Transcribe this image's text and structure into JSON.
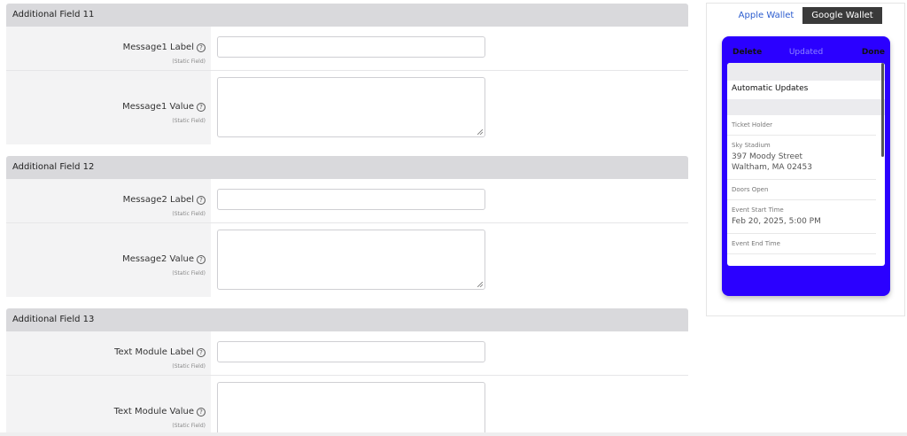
{
  "sections": [
    {
      "title": "Additional Field 11",
      "fields": [
        {
          "label": "Message1 Label",
          "sub": "(Static Field)",
          "type": "input",
          "value": ""
        },
        {
          "label": "Message1 Value",
          "sub": "(Static Field)",
          "type": "textarea",
          "value": ""
        }
      ]
    },
    {
      "title": "Additional Field 12",
      "fields": [
        {
          "label": "Message2 Label",
          "sub": "(Static Field)",
          "type": "input",
          "value": ""
        },
        {
          "label": "Message2 Value",
          "sub": "(Static Field)",
          "type": "textarea",
          "value": ""
        }
      ]
    },
    {
      "title": "Additional Field 13",
      "fields": [
        {
          "label": "Text Module Label",
          "sub": "(Static Field)",
          "type": "input",
          "value": ""
        },
        {
          "label": "Text Module Value",
          "sub": "(Static Field)",
          "type": "textarea",
          "value": ""
        }
      ]
    }
  ],
  "help_icon_glyph": "?",
  "preview": {
    "tabs": {
      "apple": "Apple Wallet",
      "google": "Google Wallet"
    },
    "phone": {
      "delete": "Delete",
      "updated": "Updated",
      "done": "Done",
      "color": "#2b00ff",
      "screen_title": "Automatic Updates",
      "items": [
        {
          "label": "Ticket Holder",
          "lines": []
        },
        {
          "label": "Sky Stadium",
          "lines": [
            "397 Moody Street",
            "Waltham, MA 02453"
          ]
        },
        {
          "label": "Doors Open",
          "lines": []
        },
        {
          "label": "Event Start Time",
          "lines": [
            "Feb 20, 2025, 5:00 PM"
          ]
        },
        {
          "label": "Event End Time",
          "lines": []
        }
      ]
    }
  }
}
